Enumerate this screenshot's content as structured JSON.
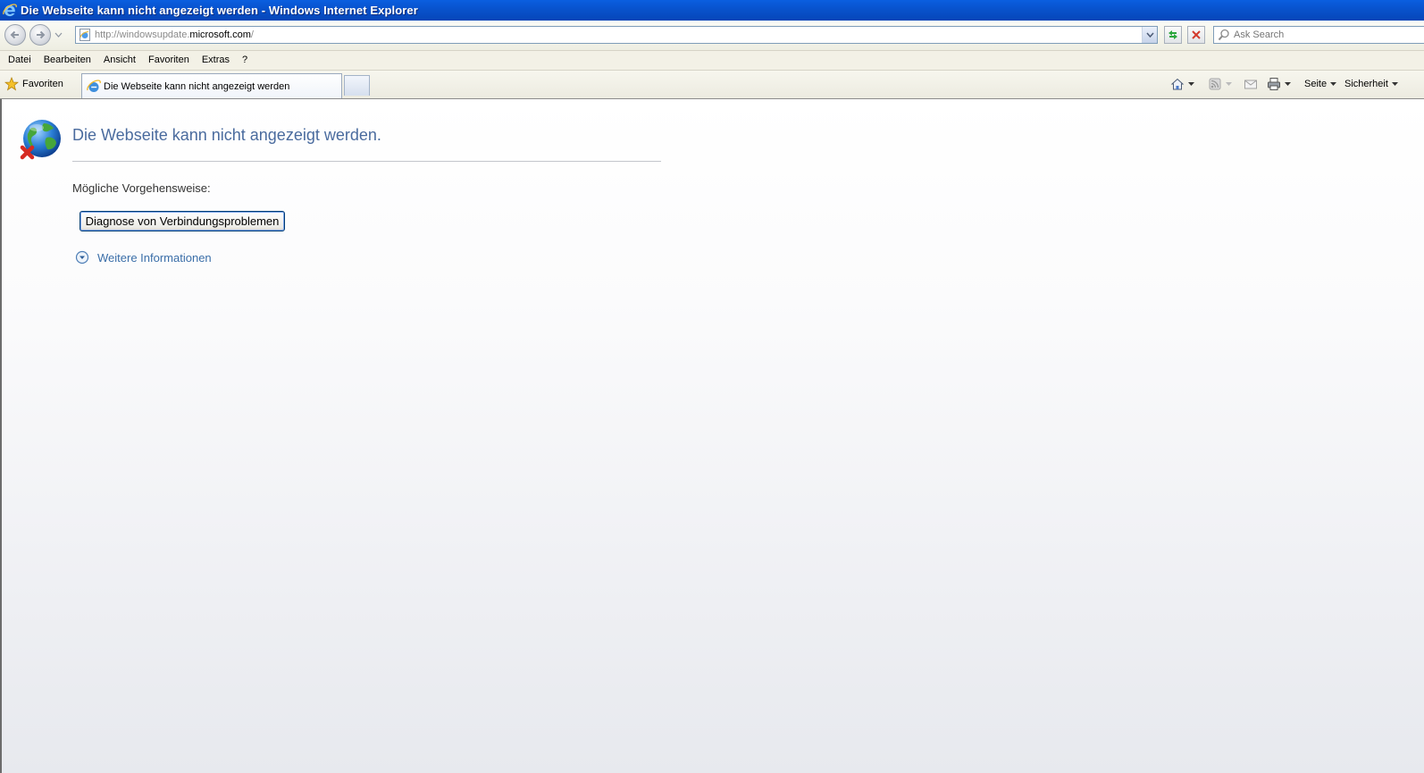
{
  "window": {
    "title": "Die Webseite kann nicht angezeigt werden - Windows Internet Explorer"
  },
  "address_bar": {
    "url_prefix": "http://windowsupdate.",
    "url_domain": "microsoft.com",
    "url_suffix": "/"
  },
  "search": {
    "placeholder": "Ask Search"
  },
  "menu": {
    "items": [
      "Datei",
      "Bearbeiten",
      "Ansicht",
      "Favoriten",
      "Extras",
      "?"
    ]
  },
  "tabs": {
    "favorites_label": "Favoriten",
    "active_tab_label": "Die Webseite kann nicht angezeigt werden"
  },
  "commands": {
    "page_label": "Seite",
    "security_label": "Sicherheit"
  },
  "error_page": {
    "title": "Die Webseite kann nicht angezeigt werden.",
    "possible_actions_label": "Mögliche Vorgehensweise:",
    "diagnose_button_label": "Diagnose von Verbindungsproblemen",
    "more_info_label": "Weitere Informationen"
  },
  "colors": {
    "title_bar": "#0852cc",
    "error_title": "#4a6b9e",
    "link": "#3a6ea8"
  }
}
